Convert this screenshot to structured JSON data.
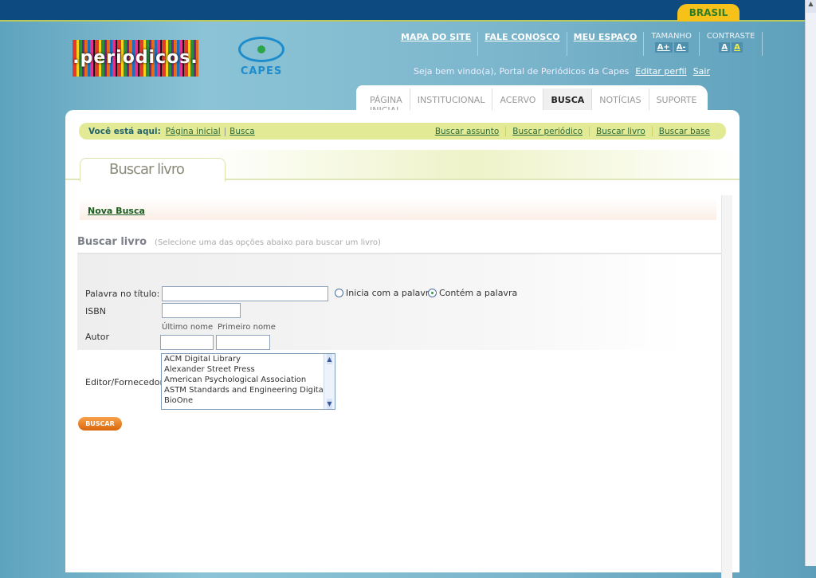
{
  "header": {
    "brasil": "BRASIL",
    "logo_periodicos": ".periodicos.",
    "logo_capes": "CAPES",
    "links": [
      "MAPA DO SITE",
      "FALE CONOSCO",
      "MEU ESPAÇO"
    ],
    "tamanho": {
      "label": "TAMANHO",
      "increase": "A+",
      "decrease": "A-"
    },
    "contraste": {
      "label": "CONTRASTE",
      "normal": "A",
      "high": "A"
    },
    "welcome": "Seja bem vindo(a), Portal de Periódicos da Capes",
    "edit_profile": "Editar perfil",
    "logout": "Sair"
  },
  "nav": {
    "tabs": [
      "PÁGINA INICIAL",
      "INSTITUCIONAL",
      "ACERVO",
      "BUSCA",
      "NOTÍCIAS",
      "SUPORTE"
    ],
    "active": "BUSCA"
  },
  "breadcrumb": {
    "label": "Você está aqui:",
    "items": [
      "Página inicial",
      "Busca"
    ],
    "sep": "|",
    "quick_links": [
      "Buscar assunto",
      "Buscar periódico",
      "Buscar livro",
      "Buscar base"
    ]
  },
  "page_tab": "Buscar livro",
  "nova_busca": "Nova Busca",
  "section": {
    "title": "Buscar livro",
    "hint": "(Selecione uma das opções abaixo para buscar um livro)"
  },
  "form": {
    "title_label": "Palavra no título:",
    "title_value": "",
    "radio_starts": "Inicia com a palavra",
    "radio_contains": "Contém a palavra",
    "radio_selected": "Contém a palavra",
    "isbn_label": "ISBN",
    "isbn_value": "",
    "author_label": "Autor",
    "last_name_label": "Último nome",
    "first_name_label": "Primeiro nome",
    "publisher_label": "Editor/Fornecedor",
    "publishers": [
      "ACM Digital Library",
      "Alexander Street Press",
      "American Psychological Association",
      "ASTM Standards and Engineering Digital Library",
      "BioOne"
    ],
    "submit": "BUSCAR"
  }
}
